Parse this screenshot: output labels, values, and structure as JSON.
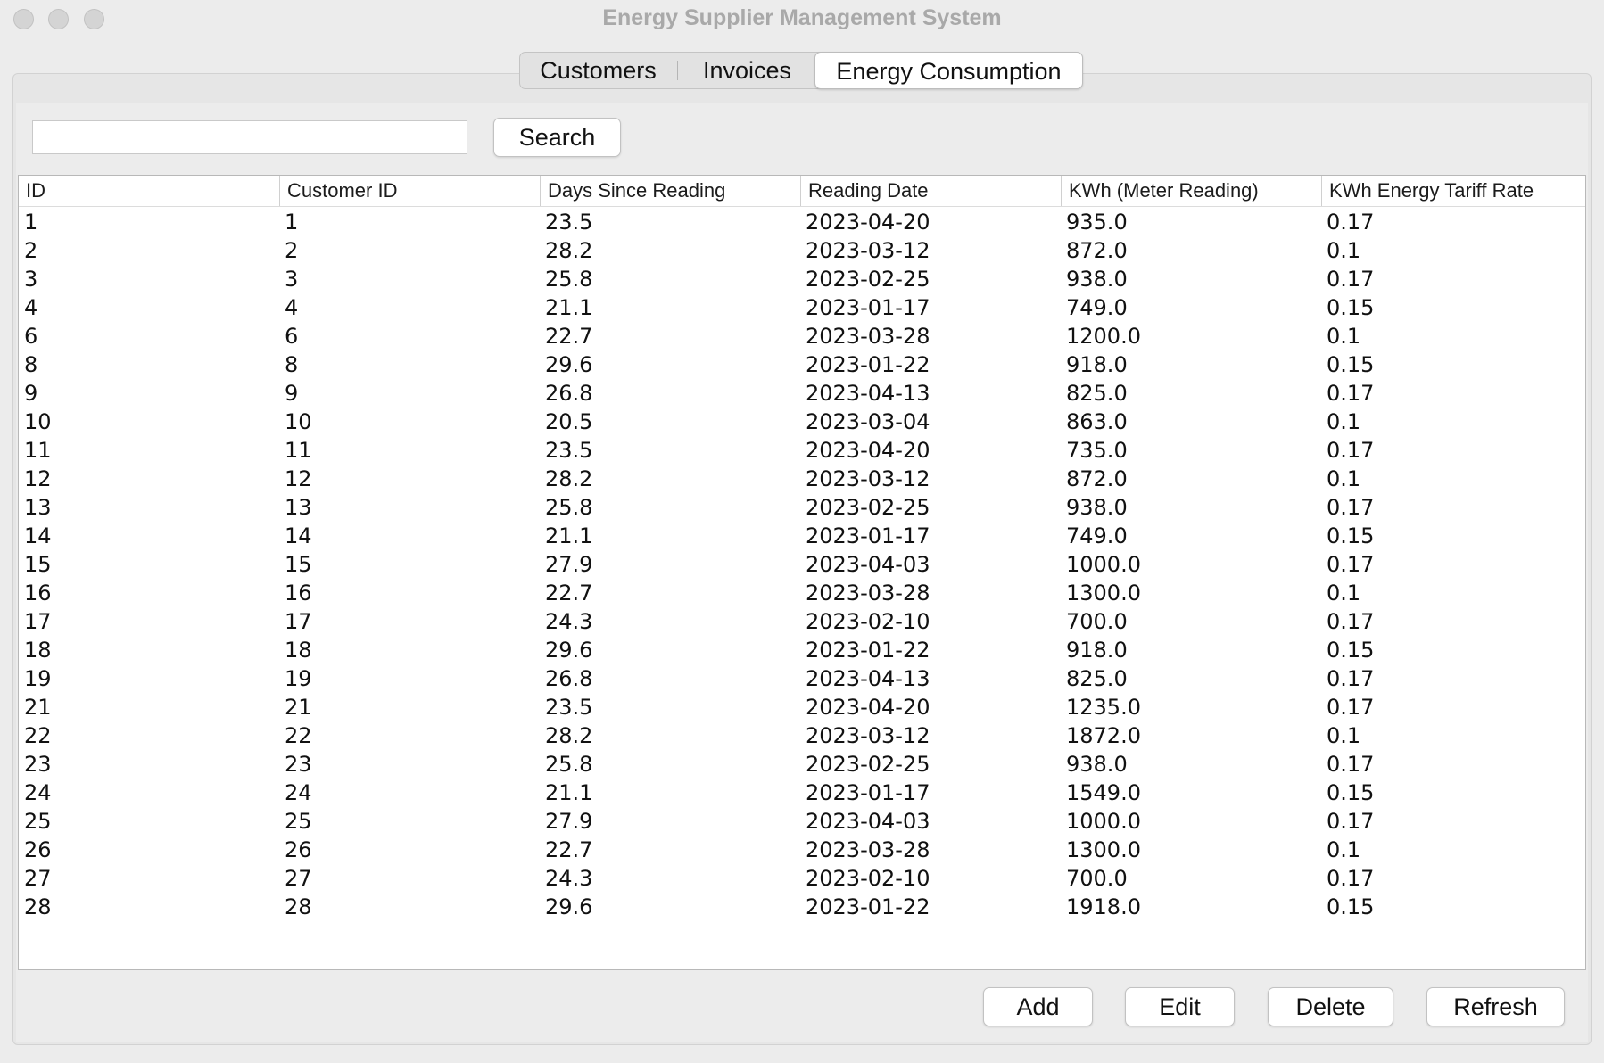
{
  "window": {
    "title": "Energy Supplier Management System"
  },
  "tabs": [
    {
      "label": "Customers",
      "selected": false
    },
    {
      "label": "Invoices",
      "selected": false
    },
    {
      "label": "Energy Consumption",
      "selected": true
    }
  ],
  "search": {
    "value": "",
    "placeholder": "",
    "button_label": "Search"
  },
  "table": {
    "columns": [
      "ID",
      "Customer ID",
      "Days Since Reading",
      "Reading Date",
      "KWh (Meter Reading)",
      "KWh Energy Tariff Rate"
    ],
    "rows": [
      [
        "1",
        "1",
        "23.5",
        "2023-04-20",
        "935.0",
        "0.17"
      ],
      [
        "2",
        "2",
        "28.2",
        "2023-03-12",
        "872.0",
        "0.1"
      ],
      [
        "3",
        "3",
        "25.8",
        "2023-02-25",
        "938.0",
        "0.17"
      ],
      [
        "4",
        "4",
        "21.1",
        "2023-01-17",
        "749.0",
        "0.15"
      ],
      [
        "6",
        "6",
        "22.7",
        "2023-03-28",
        "1200.0",
        "0.1"
      ],
      [
        "8",
        "8",
        "29.6",
        "2023-01-22",
        "918.0",
        "0.15"
      ],
      [
        "9",
        "9",
        "26.8",
        "2023-04-13",
        "825.0",
        "0.17"
      ],
      [
        "10",
        "10",
        "20.5",
        "2023-03-04",
        "863.0",
        "0.1"
      ],
      [
        "11",
        "11",
        "23.5",
        "2023-04-20",
        "735.0",
        "0.17"
      ],
      [
        "12",
        "12",
        "28.2",
        "2023-03-12",
        "872.0",
        "0.1"
      ],
      [
        "13",
        "13",
        "25.8",
        "2023-02-25",
        "938.0",
        "0.17"
      ],
      [
        "14",
        "14",
        "21.1",
        "2023-01-17",
        "749.0",
        "0.15"
      ],
      [
        "15",
        "15",
        "27.9",
        "2023-04-03",
        "1000.0",
        "0.17"
      ],
      [
        "16",
        "16",
        "22.7",
        "2023-03-28",
        "1300.0",
        "0.1"
      ],
      [
        "17",
        "17",
        "24.3",
        "2023-02-10",
        "700.0",
        "0.17"
      ],
      [
        "18",
        "18",
        "29.6",
        "2023-01-22",
        "918.0",
        "0.15"
      ],
      [
        "19",
        "19",
        "26.8",
        "2023-04-13",
        "825.0",
        "0.17"
      ],
      [
        "21",
        "21",
        "23.5",
        "2023-04-20",
        "1235.0",
        "0.17"
      ],
      [
        "22",
        "22",
        "28.2",
        "2023-03-12",
        "1872.0",
        "0.1"
      ],
      [
        "23",
        "23",
        "25.8",
        "2023-02-25",
        "938.0",
        "0.17"
      ],
      [
        "24",
        "24",
        "21.1",
        "2023-01-17",
        "1549.0",
        "0.15"
      ],
      [
        "25",
        "25",
        "27.9",
        "2023-04-03",
        "1000.0",
        "0.17"
      ],
      [
        "26",
        "26",
        "22.7",
        "2023-03-28",
        "1300.0",
        "0.1"
      ],
      [
        "27",
        "27",
        "24.3",
        "2023-02-10",
        "700.0",
        "0.17"
      ],
      [
        "28",
        "28",
        "29.6",
        "2023-01-22",
        "1918.0",
        "0.15"
      ]
    ]
  },
  "actions": {
    "add": "Add",
    "edit": "Edit",
    "delete": "Delete",
    "refresh": "Refresh"
  }
}
